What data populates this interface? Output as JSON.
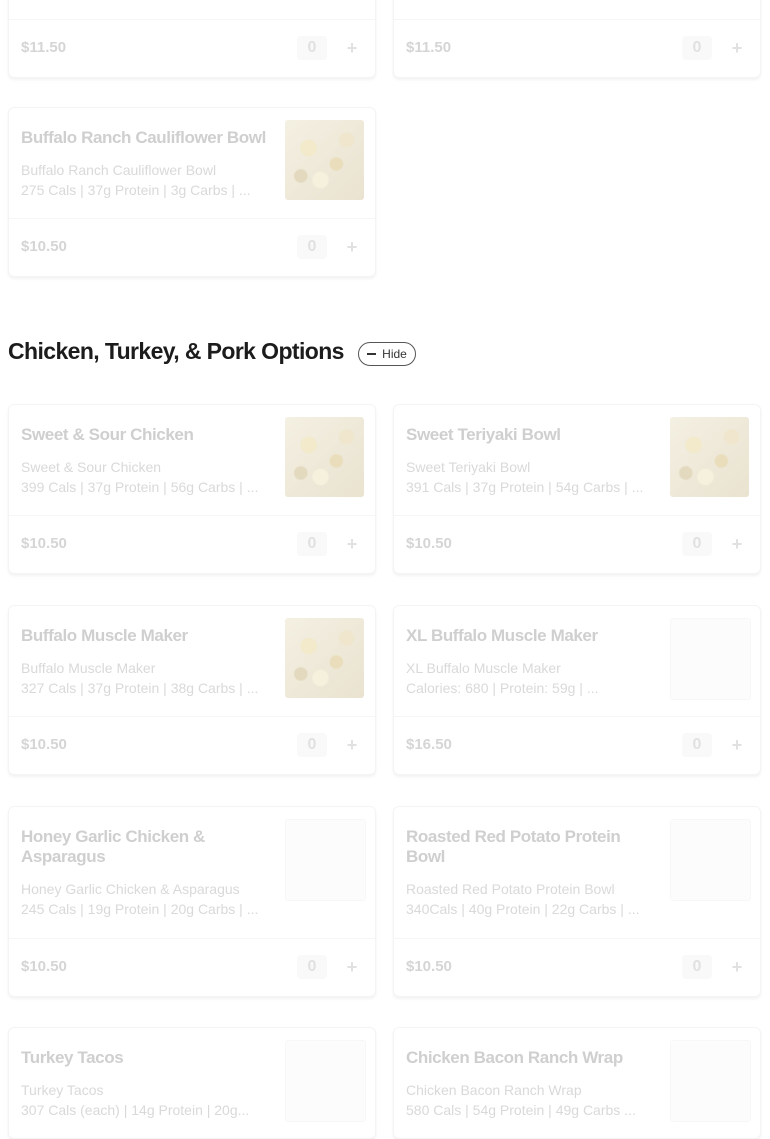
{
  "cards": [
    {
      "name": "",
      "line1": "",
      "line2": "",
      "price": "$11.50",
      "qty": "0",
      "image": false
    },
    {
      "name": "",
      "line1": "",
      "line2": "",
      "price": "$11.50",
      "qty": "0",
      "image": false
    },
    {
      "name": "Buffalo Ranch Cauliflower Bowl",
      "line1": "Buffalo Ranch Cauliflower Bowl",
      "line2": "275 Cals | 37g Protein | 3g Carbs | ...",
      "price": "$10.50",
      "qty": "0",
      "image": true
    },
    {
      "name": "Sweet & Sour Chicken",
      "line1": "Sweet & Sour Chicken",
      "line2": "399 Cals | 37g Protein | 56g Carbs | ...",
      "price": "$10.50",
      "qty": "0",
      "image": true
    },
    {
      "name": "Sweet Teriyaki Bowl",
      "line1": "Sweet Teriyaki Bowl",
      "line2": "391 Cals | 37g Protein | 54g Carbs | ...",
      "price": "$10.50",
      "qty": "0",
      "image": true
    },
    {
      "name": "Buffalo Muscle Maker",
      "line1": "Buffalo Muscle Maker",
      "line2": "327 Cals | 37g Protein | 38g Carbs | ...",
      "price": "$10.50",
      "qty": "0",
      "image": true
    },
    {
      "name": "XL Buffalo Muscle Maker",
      "line1": "XL Buffalo Muscle Maker",
      "line2": "Calories: 680 | Protein: 59g | ...",
      "price": "$16.50",
      "qty": "0",
      "image": false
    },
    {
      "name": "Honey Garlic Chicken & Asparagus",
      "line1": "Honey Garlic Chicken & Asparagus",
      "line2": "245 Cals | 19g Protein | 20g Carbs | ...",
      "price": "$10.50",
      "qty": "0",
      "image": false
    },
    {
      "name": "Roasted Red Potato Protein Bowl",
      "line1": "Roasted Red Potato Protein Bowl",
      "line2": "340Cals | 40g Protein | 22g Carbs | ...",
      "price": "$10.50",
      "qty": "0",
      "image": false
    },
    {
      "name": "Turkey Tacos",
      "line1": "Turkey Tacos",
      "line2": "307 Cals (each) | 14g Protein | 20g...",
      "price": "",
      "qty": "",
      "image": false
    },
    {
      "name": "Chicken Bacon Ranch Wrap",
      "line1": "Chicken Bacon Ranch Wrap",
      "line2": "580 Cals | 54g Protein | 49g Carbs ...",
      "price": "",
      "qty": "",
      "image": false
    }
  ],
  "section": {
    "title": "Chicken, Turkey, & Pork Options",
    "hide_label": "Hide"
  },
  "icons": {
    "plus": "+"
  }
}
